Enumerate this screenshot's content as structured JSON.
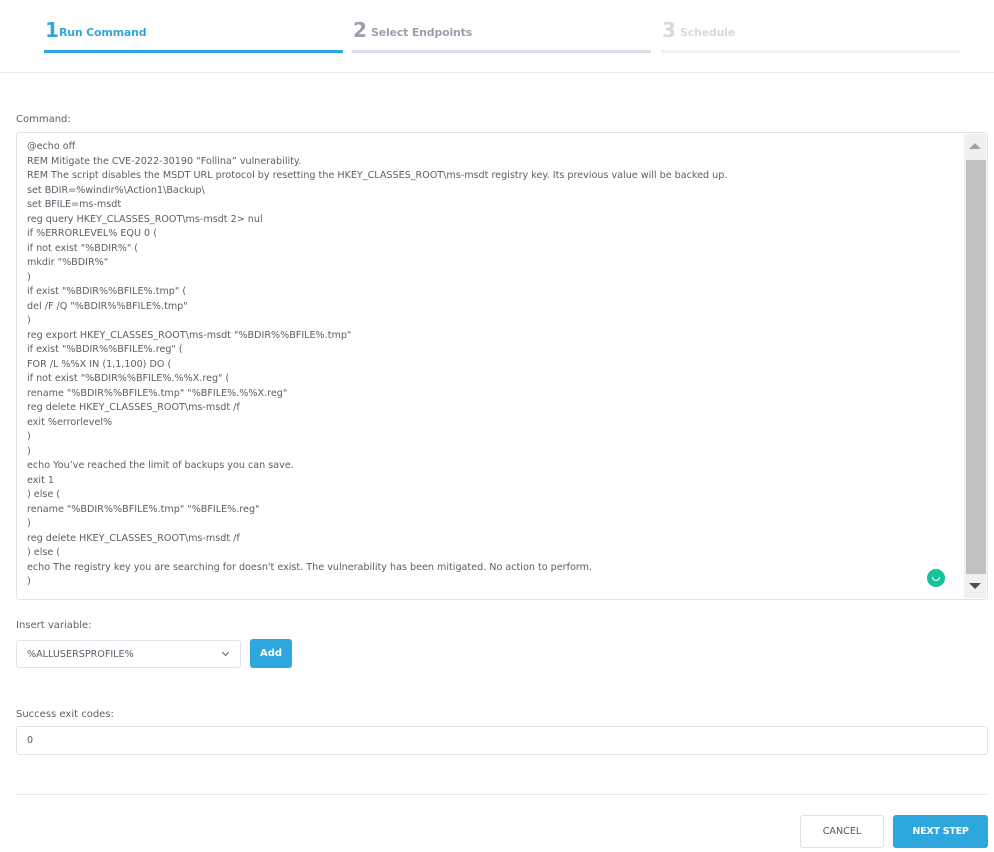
{
  "stepper": {
    "steps": [
      {
        "number": "1",
        "label": "Run Command",
        "state": "active"
      },
      {
        "number": "2",
        "label": "Select Endpoints",
        "state": "next"
      },
      {
        "number": "3",
        "label": "Schedule",
        "state": "disabled"
      }
    ]
  },
  "command": {
    "label": "Command:",
    "value": "@echo off\nREM Mitigate the CVE-2022-30190 “Follina” vulnerability.\nREM The script disables the MSDT URL protocol by resetting the HKEY_CLASSES_ROOT\\ms-msdt registry key. Its previous value will be backed up.\nset BDIR=%windir%\\Action1\\Backup\\\nset BFILE=ms-msdt\nreg query HKEY_CLASSES_ROOT\\ms-msdt 2> nul\nif %ERRORLEVEL% EQU 0 (\nif not exist \"%BDIR%\" (\nmkdir \"%BDIR%\"\n)\nif exist \"%BDIR%%BFILE%.tmp\" (\ndel /F /Q \"%BDIR%%BFILE%.tmp\"\n)\nreg export HKEY_CLASSES_ROOT\\ms-msdt \"%BDIR%%BFILE%.tmp\"\nif exist \"%BDIR%%BFILE%.reg\" (\nFOR /L %%X IN (1,1,100) DO (\nif not exist \"%BDIR%%BFILE%.%%X.reg\" (\nrename \"%BDIR%%BFILE%.tmp\" \"%BFILE%.%%X.reg\"\nreg delete HKEY_CLASSES_ROOT\\ms-msdt /f\nexit %errorlevel%\n)\n)\necho You’ve reached the limit of backups you can save.\nexit 1\n) else (\nrename \"%BDIR%%BFILE%.tmp\" \"%BFILE%.reg\"\n)\nreg delete HKEY_CLASSES_ROOT\\ms-msdt /f\n) else (\necho The registry key you are searching for doesn't exist. The vulnerability has been mitigated. No action to perform.\n)"
  },
  "insert_variable": {
    "label": "Insert variable:",
    "selected": "%ALLUSERSPROFILE%",
    "add_label": "Add"
  },
  "exit_codes": {
    "label": "Success exit codes:",
    "value": "0"
  },
  "footer": {
    "cancel_label": "CANCEL",
    "next_label": "NEXT STEP"
  },
  "colors": {
    "accent": "#2ea7de",
    "grammarly": "#15c39a"
  }
}
